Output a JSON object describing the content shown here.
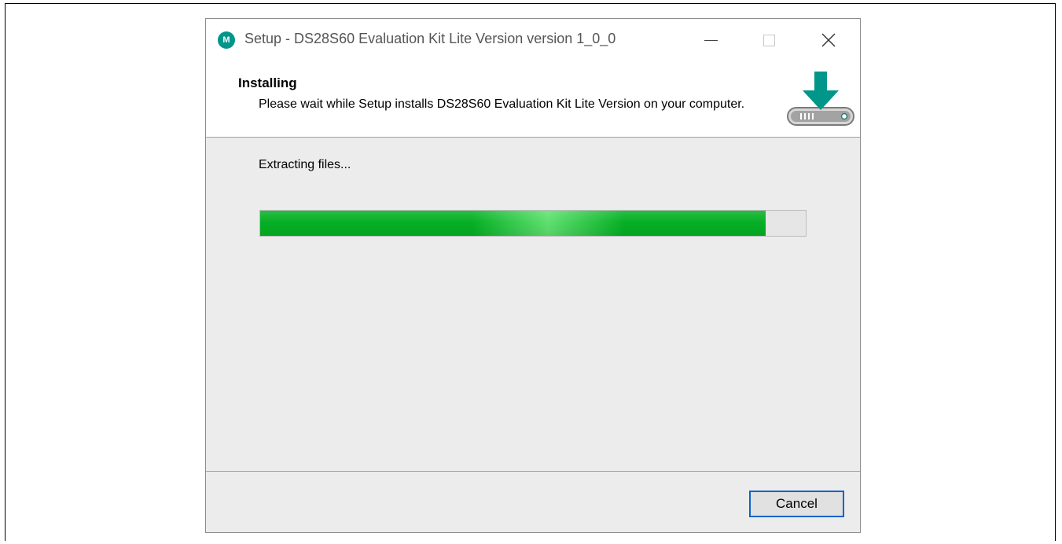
{
  "window": {
    "title": "Setup - DS28S60 Evaluation Kit Lite Version version 1_0_0",
    "logo_text": "M",
    "controls": {
      "minimize_icon": "minimize-icon",
      "maximize_icon": "maximize-icon",
      "close_icon": "close-icon"
    }
  },
  "header": {
    "title": "Installing",
    "description": "Please wait while Setup installs DS28S60 Evaluation Kit Lite Version on your computer.",
    "icon": "download-to-disk-icon"
  },
  "content": {
    "status": "Extracting files...",
    "progress_fraction": 0.927
  },
  "footer": {
    "cancel_label": "Cancel"
  },
  "colors": {
    "accent": "#00968a",
    "progress": "#06b025",
    "button_focus": "#0b63c9"
  }
}
